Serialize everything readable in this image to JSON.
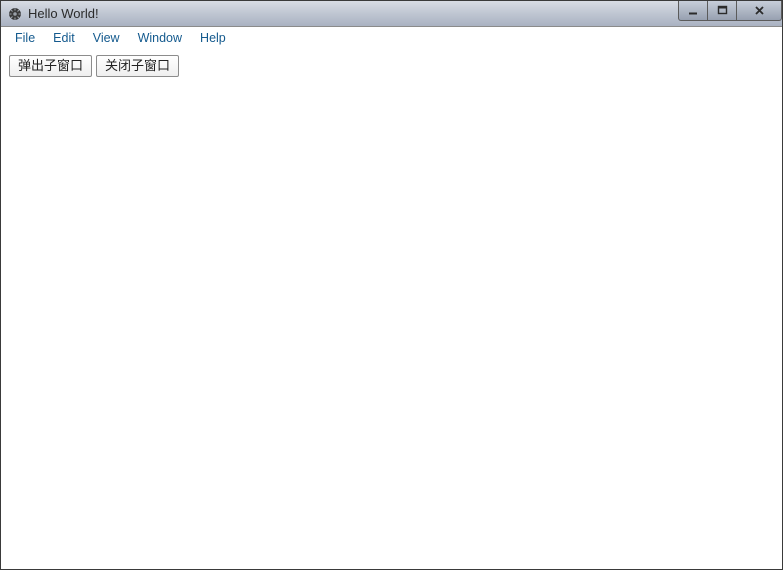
{
  "window": {
    "title": "Hello World!"
  },
  "menu": {
    "file": "File",
    "edit": "Edit",
    "view": "View",
    "window": "Window",
    "help": "Help"
  },
  "buttons": {
    "open_child": "弹出子窗口",
    "close_child": "关闭子窗口"
  }
}
